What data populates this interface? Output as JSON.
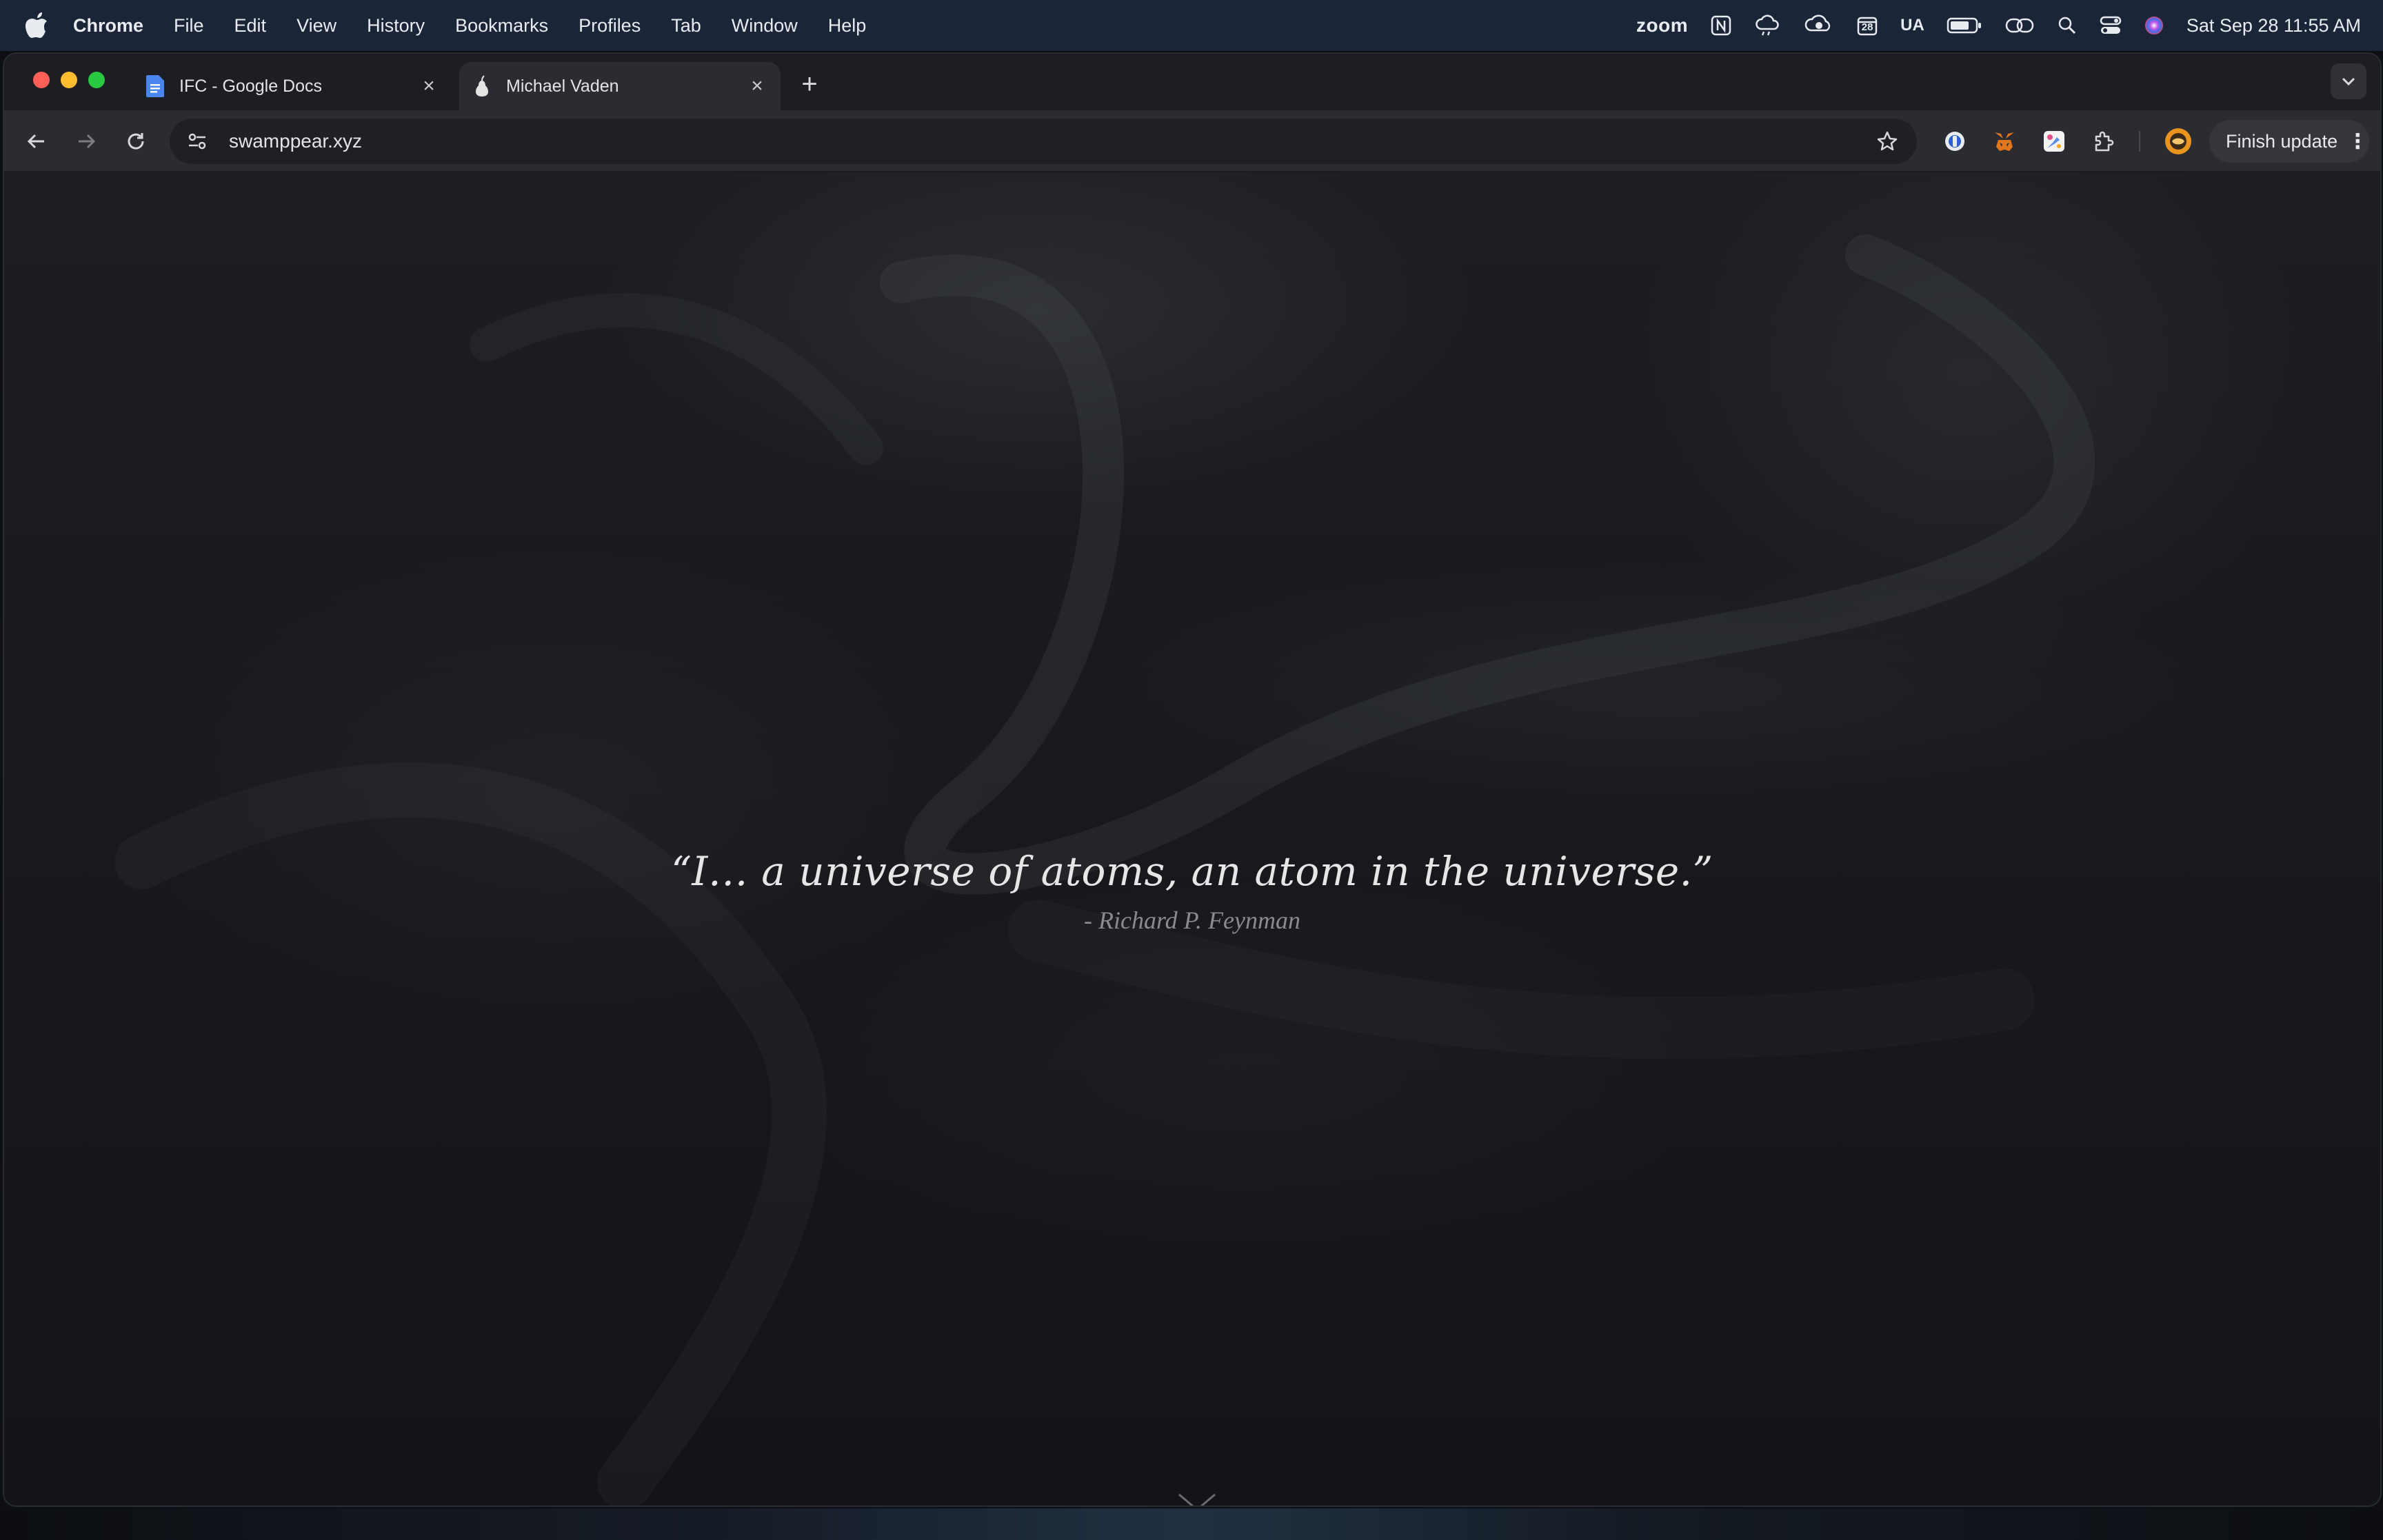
{
  "menubar": {
    "app_name": "Chrome",
    "menus": [
      "File",
      "Edit",
      "View",
      "History",
      "Bookmarks",
      "Profiles",
      "Tab",
      "Window",
      "Help"
    ],
    "status": {
      "zoom_label": "zoom",
      "calendar_day": "28",
      "input_source": "UA"
    },
    "clock": "Sat Sep 28  11:55 AM"
  },
  "browser": {
    "tabs": [
      {
        "title": "IFC - Google Docs",
        "icon": "google-docs-icon",
        "active": false
      },
      {
        "title": "Michael Vaden",
        "icon": "pear-icon",
        "active": true
      }
    ],
    "address": "swamppear.xyz",
    "finish_update_label": "Finish update"
  },
  "page": {
    "quote": "“I… a universe of atoms, an atom in the universe.”",
    "attribution": "- Richard P. Feynman"
  },
  "colors": {
    "menubar_bg": "#1a2538",
    "tab_active_bg": "#2a2c32",
    "page_bg": "#18191d",
    "quote_text": "#e6e6e6",
    "attribution_text": "#8a8b90",
    "traffic_red": "#ff5f57",
    "traffic_yellow": "#febc2e",
    "traffic_green": "#28c840"
  }
}
